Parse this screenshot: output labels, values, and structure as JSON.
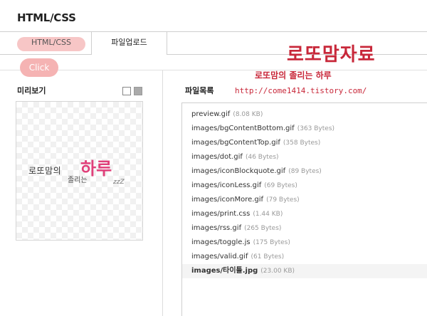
{
  "page": {
    "title": "HTML/CSS"
  },
  "tabs": [
    {
      "label": "HTML/CSS",
      "active": false,
      "highlight_color": "#f6bcbc"
    },
    {
      "label": "파일업로드",
      "active": true
    }
  ],
  "annotation": {
    "click_label": "Click",
    "color": "#f5b3b3"
  },
  "preview": {
    "title": "미리보기",
    "bg_options": [
      "white",
      "gray"
    ],
    "image": {
      "text_left": "로또맘의",
      "text_sub": "졸리는",
      "text_big": "하루",
      "text_zz": "zzZ"
    }
  },
  "filelist": {
    "title": "파일목록",
    "files": [
      {
        "name": "preview.gif",
        "size": "(8.08 KB)"
      },
      {
        "name": "images/bgContentBottom.gif",
        "size": "(363 Bytes)"
      },
      {
        "name": "images/bgContentTop.gif",
        "size": "(358 Bytes)"
      },
      {
        "name": "images/dot.gif",
        "size": "(46 Bytes)"
      },
      {
        "name": "images/iconBlockquote.gif",
        "size": "(89 Bytes)"
      },
      {
        "name": "images/iconLess.gif",
        "size": "(69 Bytes)"
      },
      {
        "name": "images/iconMore.gif",
        "size": "(79 Bytes)"
      },
      {
        "name": "images/print.css",
        "size": "(1.44 KB)"
      },
      {
        "name": "images/rss.gif",
        "size": "(265 Bytes)"
      },
      {
        "name": "images/toggle.js",
        "size": "(175 Bytes)"
      },
      {
        "name": "images/valid.gif",
        "size": "(61 Bytes)"
      },
      {
        "name": "images/타이틀.jpg",
        "size": "(23.00 KB)",
        "selected": true
      }
    ]
  },
  "overlay": {
    "title": "로또맘자료",
    "subtitle": "로또맘의 졸리는 하루",
    "url": "http://come1414.tistory.com/",
    "color": "#c8283a"
  }
}
